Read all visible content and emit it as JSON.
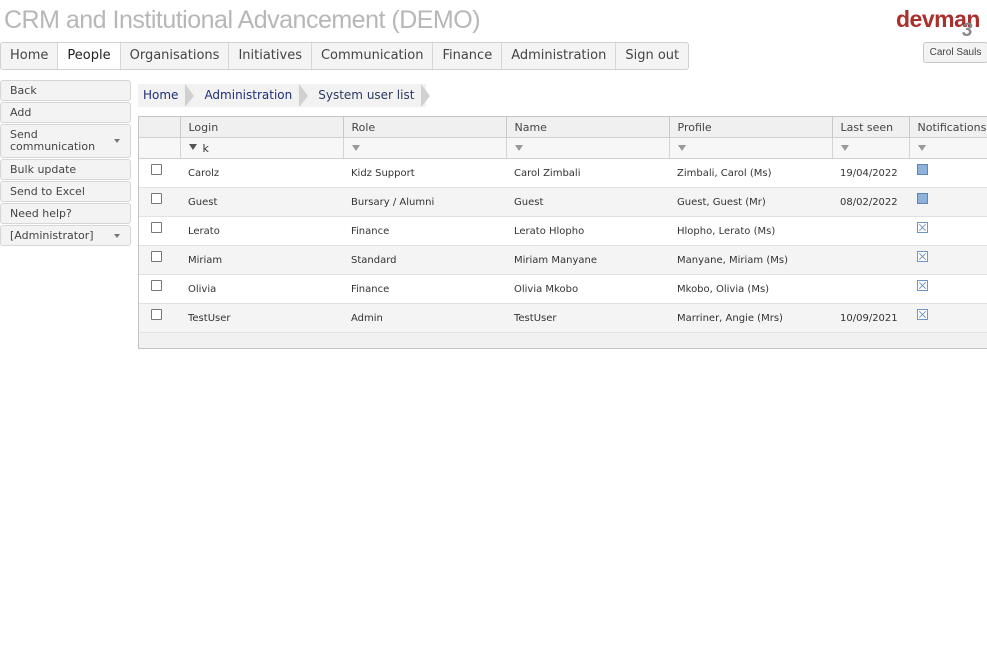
{
  "header": {
    "title": "CRM and Institutional Advancement (DEMO)",
    "logo_text": "devman",
    "logo_mark": "3",
    "user": "Carol Sauls"
  },
  "nav": {
    "tabs": [
      "Home",
      "People",
      "Organisations",
      "Initiatives",
      "Communication",
      "Finance",
      "Administration",
      "Sign out"
    ],
    "active": "People"
  },
  "sidebar": {
    "items": [
      "Back",
      "Add",
      "Send communication",
      "Bulk update",
      "Send to Excel",
      "Need help?",
      "[Administrator]"
    ]
  },
  "breadcrumb": [
    "Home",
    "Administration",
    "System user list"
  ],
  "table": {
    "columns": [
      "Login",
      "Role",
      "Name",
      "Profile",
      "Last seen",
      "Notifications"
    ],
    "login_filter": "k",
    "rows": [
      {
        "login": "Carolz",
        "role": "Kidz Support",
        "name": "Carol Zimbali",
        "profile": "Zimbali, Carol (Ms)",
        "last_seen": "19/04/2022",
        "notifications": "on"
      },
      {
        "login": "Guest",
        "role": "Bursary / Alumni",
        "name": "Guest",
        "profile": "Guest, Guest (Mr)",
        "last_seen": "08/02/2022",
        "notifications": "on"
      },
      {
        "login": "Lerato",
        "role": "Finance",
        "name": "Lerato Hlopho",
        "profile": "Hlopho, Lerato (Ms)",
        "last_seen": "",
        "notifications": "off"
      },
      {
        "login": "Miriam",
        "role": "Standard",
        "name": "Miriam Manyane",
        "profile": "Manyane, Miriam (Ms)",
        "last_seen": "",
        "notifications": "off"
      },
      {
        "login": "Olivia",
        "role": "Finance",
        "name": "Olivia Mkobo",
        "profile": "Mkobo, Olivia (Ms)",
        "last_seen": "",
        "notifications": "off"
      },
      {
        "login": "TestUser",
        "role": "Admin",
        "name": "TestUser",
        "profile": "Marriner, Angie (Mrs)",
        "last_seen": "10/09/2021",
        "notifications": "off"
      }
    ]
  },
  "colors": {
    "title": "#b7b7b7",
    "logo": "#a8312d",
    "link": "#1d2f78"
  }
}
